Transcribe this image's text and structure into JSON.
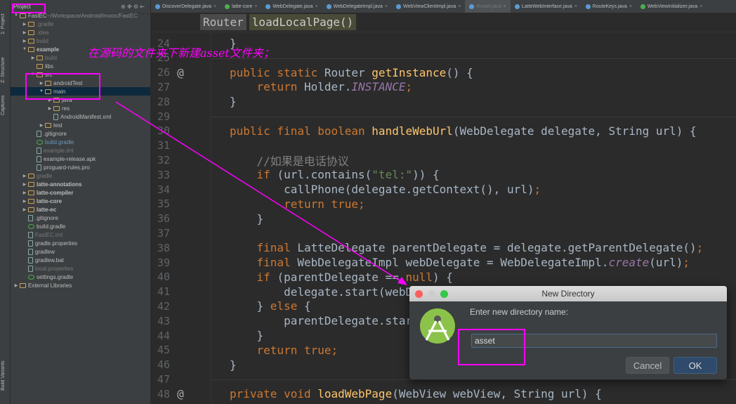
{
  "side_tabs": {
    "project": "1: Project",
    "structure": "Z: Structure",
    "captures": "Captures",
    "build_variants": "Build Variants"
  },
  "tree": {
    "header": "Project",
    "items": [
      {
        "label": "FastEC",
        "suffix": " ~/Workspace/Android/Imooc/FastEC",
        "depth": 0,
        "arrow": "▼",
        "type": "folder"
      },
      {
        "label": ".gradle",
        "depth": 1,
        "arrow": "▶",
        "type": "folder",
        "dim": true
      },
      {
        "label": ".idea",
        "depth": 1,
        "arrow": "▶",
        "type": "folder",
        "dim": true
      },
      {
        "label": "build",
        "depth": 1,
        "arrow": "▶",
        "type": "folder",
        "dim": true
      },
      {
        "label": "example",
        "depth": 1,
        "arrow": "▼",
        "type": "folder",
        "bold": true
      },
      {
        "label": "build",
        "depth": 2,
        "arrow": "▶",
        "type": "folder",
        "dim": true
      },
      {
        "label": "libs",
        "depth": 2,
        "arrow": "",
        "type": "folder"
      },
      {
        "label": "src",
        "depth": 2,
        "arrow": "▼",
        "type": "folder"
      },
      {
        "label": "androidTest",
        "depth": 3,
        "arrow": "▶",
        "type": "folder"
      },
      {
        "label": "main",
        "depth": 3,
        "arrow": "▼",
        "type": "folder",
        "selected": true
      },
      {
        "label": "java",
        "depth": 4,
        "arrow": "▶",
        "type": "folder"
      },
      {
        "label": "res",
        "depth": 4,
        "arrow": "▶",
        "type": "folder"
      },
      {
        "label": "AndroidManifest.xml",
        "depth": 4,
        "arrow": "",
        "type": "file"
      },
      {
        "label": "test",
        "depth": 3,
        "arrow": "▶",
        "type": "folder"
      },
      {
        "label": ".gitignore",
        "depth": 2,
        "arrow": "",
        "type": "file"
      },
      {
        "label": "build.gradle",
        "depth": 2,
        "arrow": "",
        "type": "gradle",
        "blue": true
      },
      {
        "label": "example.iml",
        "depth": 2,
        "arrow": "",
        "type": "file",
        "dim": true
      },
      {
        "label": "example-release.apk",
        "depth": 2,
        "arrow": "",
        "type": "file"
      },
      {
        "label": "proguard-rules.pro",
        "depth": 2,
        "arrow": "",
        "type": "file"
      },
      {
        "label": "gradle",
        "depth": 1,
        "arrow": "▶",
        "type": "folder",
        "dim": true
      },
      {
        "label": "latte-annotations",
        "depth": 1,
        "arrow": "▶",
        "type": "folder",
        "bold": true
      },
      {
        "label": "latte-compiler",
        "depth": 1,
        "arrow": "▶",
        "type": "folder",
        "bold": true
      },
      {
        "label": "latte-core",
        "depth": 1,
        "arrow": "▶",
        "type": "folder",
        "bold": true
      },
      {
        "label": "latte-ec",
        "depth": 1,
        "arrow": "▶",
        "type": "folder",
        "bold": true
      },
      {
        "label": ".gitignore",
        "depth": 1,
        "arrow": "",
        "type": "file"
      },
      {
        "label": "build.gradle",
        "depth": 1,
        "arrow": "",
        "type": "gradle"
      },
      {
        "label": "FastEC.iml",
        "depth": 1,
        "arrow": "",
        "type": "file",
        "dim": true
      },
      {
        "label": "gradle.properties",
        "depth": 1,
        "arrow": "",
        "type": "file"
      },
      {
        "label": "gradlew",
        "depth": 1,
        "arrow": "",
        "type": "file"
      },
      {
        "label": "gradlew.bat",
        "depth": 1,
        "arrow": "",
        "type": "file"
      },
      {
        "label": "local.properties",
        "depth": 1,
        "arrow": "",
        "type": "file",
        "dim": true
      },
      {
        "label": "settings.gradle",
        "depth": 1,
        "arrow": "",
        "type": "gradle"
      },
      {
        "label": "External Libraries",
        "depth": 0,
        "arrow": "▶",
        "type": "lib"
      }
    ]
  },
  "tabs": [
    {
      "label": "DiscoverDelegate.java"
    },
    {
      "label": "latte-core",
      "color": "#4caf50"
    },
    {
      "label": "WebDelegate.java"
    },
    {
      "label": "WebDelegateImpl.java"
    },
    {
      "label": "WebViewClientImpl.java"
    },
    {
      "label": "Router.java",
      "active": true
    },
    {
      "label": "LatteWebInterface.java"
    },
    {
      "label": "RouteKeys.java"
    },
    {
      "label": "WebViewInitializer.java",
      "color": "#4caf50"
    }
  ],
  "breadcrumb": {
    "class": "Router",
    "method": "loadLocalPage()"
  },
  "code": [
    {
      "n": "24",
      "t": [
        [
          "p",
          "}"
        ]
      ]
    },
    {
      "n": "25",
      "t": []
    },
    {
      "n": "26",
      "a": "@",
      "t": [
        [
          "k",
          "public static "
        ],
        [
          "p",
          "Router "
        ],
        [
          "f",
          "getInstance"
        ],
        [
          "p",
          "() {"
        ]
      ]
    },
    {
      "n": "27",
      "t": [
        [
          "k",
          "    return "
        ],
        [
          "p",
          "Holder."
        ],
        [
          "i",
          "INSTANCE"
        ],
        [
          "k",
          ";"
        ]
      ]
    },
    {
      "n": "28",
      "t": [
        [
          "p",
          "}"
        ]
      ]
    },
    {
      "n": "29",
      "t": []
    },
    {
      "n": "30",
      "t": [
        [
          "k",
          "public final boolean "
        ],
        [
          "f",
          "handleWebUrl"
        ],
        [
          "p",
          "(WebDelegate delegate, String url) {"
        ]
      ]
    },
    {
      "n": "31",
      "t": []
    },
    {
      "n": "32",
      "t": [
        [
          "c",
          "    //如果是电话协议"
        ]
      ]
    },
    {
      "n": "33",
      "t": [
        [
          "k",
          "    if "
        ],
        [
          "p",
          "(url.contains("
        ],
        [
          "s",
          "\"tel:\""
        ],
        [
          "p",
          ")) {"
        ]
      ]
    },
    {
      "n": "34",
      "t": [
        [
          "p",
          "        callPhone(delegate.getContext(), url)"
        ],
        [
          "k",
          ";"
        ]
      ]
    },
    {
      "n": "35",
      "t": [
        [
          "k",
          "        return true;"
        ]
      ]
    },
    {
      "n": "36",
      "t": [
        [
          "p",
          "    }"
        ]
      ]
    },
    {
      "n": "37",
      "t": []
    },
    {
      "n": "38",
      "t": [
        [
          "k",
          "    final "
        ],
        [
          "p",
          "LatteDelegate parentDelegate = delegate.getParentDelegate()"
        ],
        [
          "k",
          ";"
        ]
      ]
    },
    {
      "n": "39",
      "t": [
        [
          "k",
          "    final "
        ],
        [
          "p",
          "WebDelegateImpl webDelegate = WebDelegateImpl."
        ],
        [
          "i",
          "create"
        ],
        [
          "p",
          "(url)"
        ],
        [
          "k",
          ";"
        ]
      ]
    },
    {
      "n": "40",
      "t": [
        [
          "k",
          "    if "
        ],
        [
          "p",
          "(parentDelegate == "
        ],
        [
          "k",
          "null"
        ],
        [
          "p",
          ") {"
        ]
      ]
    },
    {
      "n": "41",
      "t": [
        [
          "p",
          "        delegate.start(webDelegate)"
        ],
        [
          "k",
          ";"
        ]
      ]
    },
    {
      "n": "42",
      "t": [
        [
          "p",
          "    } "
        ],
        [
          "k",
          "else "
        ],
        [
          "p",
          "{"
        ]
      ]
    },
    {
      "n": "43",
      "t": [
        [
          "p",
          "        parentDelegate.start(webDelegate)"
        ],
        [
          "k",
          ";"
        ]
      ]
    },
    {
      "n": "44",
      "t": [
        [
          "p",
          "    }"
        ]
      ]
    },
    {
      "n": "45",
      "t": [
        [
          "k",
          "    return true;"
        ]
      ]
    },
    {
      "n": "46",
      "t": [
        [
          "p",
          "}"
        ]
      ]
    },
    {
      "n": "47",
      "t": []
    },
    {
      "n": "48",
      "a": "@",
      "t": [
        [
          "k",
          "private void "
        ],
        [
          "f",
          "loadWebPage"
        ],
        [
          "p",
          "(WebView webView, String url) {"
        ]
      ]
    }
  ],
  "dialog": {
    "title": "New Directory",
    "label": "Enter new directory name:",
    "value": "asset",
    "cancel": "Cancel",
    "ok": "OK"
  },
  "annotation": {
    "text": "在源码的文件夹下新建asset文件夹；",
    "color": "#ff00ff"
  }
}
